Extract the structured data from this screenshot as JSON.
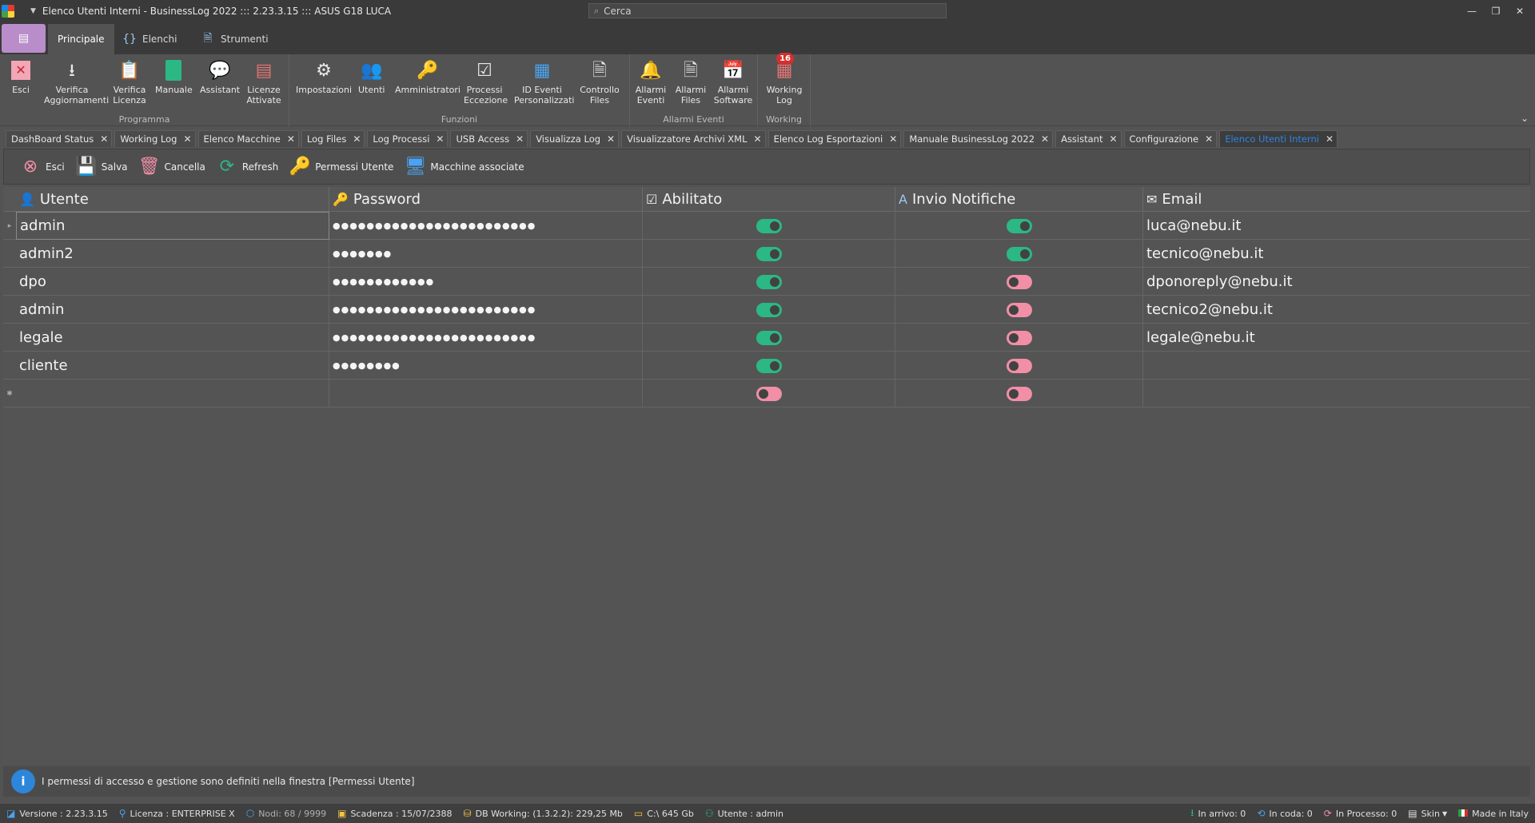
{
  "window": {
    "title": "Elenco Utenti Interni - BusinessLog 2022 ::: 2.23.3.15 ::: ASUS G18 LUCA",
    "search_placeholder": "Cerca"
  },
  "ribbon_tabs": [
    "Principale",
    "Elenchi",
    "Strumenti"
  ],
  "ribbon": {
    "programma": {
      "label": "Programma",
      "buttons": [
        "Esci",
        "Verifica Aggiornamenti",
        "Verifica Licenza",
        "Manuale",
        "Assistant",
        "Licenze Attivate"
      ]
    },
    "funzioni": {
      "label": "Funzioni",
      "buttons": [
        "Impostazioni",
        "Utenti",
        "Amministratori",
        "Processi Eccezione",
        "ID Eventi Personalizzati",
        "Controllo Files"
      ]
    },
    "allarmi": {
      "label": "Allarmi Eventi",
      "buttons": [
        "Allarmi Eventi",
        "Allarmi Files",
        "Allarmi Software"
      ]
    },
    "working": {
      "label": "Working",
      "buttons": [
        "Working Log"
      ],
      "badge": "16"
    }
  },
  "doc_tabs": [
    "DashBoard Status",
    "Working Log",
    "Elenco Macchine",
    "Log Files",
    "Log Processi",
    "USB Access",
    "Visualizza Log",
    "Visualizzatore Archivi XML",
    "Elenco Log Esportazioni",
    "Manuale BusinessLog 2022",
    "Assistant",
    "Configurazione",
    "Elenco Utenti Interni"
  ],
  "toolbar": {
    "esci": "Esci",
    "salva": "Salva",
    "cancella": "Cancella",
    "refresh": "Refresh",
    "permessi": "Permessi Utente",
    "macchine": "Macchine associate"
  },
  "grid": {
    "headers": [
      "Utente",
      "Password",
      "Abilitato",
      "Invio Notifiche",
      "Email"
    ],
    "rows": [
      {
        "utente": "admin",
        "password": "●●●●●●●●●●●●●●●●●●●●●●●●",
        "abilitato": true,
        "notifiche": true,
        "email": "luca@nebu.it"
      },
      {
        "utente": "admin2",
        "password": "●●●●●●●",
        "abilitato": true,
        "notifiche": true,
        "email": "tecnico@nebu.it"
      },
      {
        "utente": "dpo",
        "password": "●●●●●●●●●●●●",
        "abilitato": true,
        "notifiche": false,
        "email": "dponoreply@nebu.it"
      },
      {
        "utente": "admin",
        "password": "●●●●●●●●●●●●●●●●●●●●●●●●",
        "abilitato": true,
        "notifiche": false,
        "email": "tecnico2@nebu.it"
      },
      {
        "utente": "legale",
        "password": "●●●●●●●●●●●●●●●●●●●●●●●●",
        "abilitato": true,
        "notifiche": false,
        "email": "legale@nebu.it"
      },
      {
        "utente": "cliente",
        "password": "●●●●●●●●",
        "abilitato": true,
        "notifiche": false,
        "email": ""
      },
      {
        "utente": "",
        "password": "",
        "abilitato": false,
        "notifiche": false,
        "email": ""
      }
    ]
  },
  "info_message": "I permessi di accesso e gestione sono definiti nella finestra [Permessi Utente]",
  "statusbar": {
    "versione": "Versione : 2.23.3.15",
    "licenza": "Licenza : ENTERPRISE X",
    "nodi": "Nodi: 68 / 9999",
    "scadenza": "Scadenza : 15/07/2388",
    "db": "DB Working: (1.3.2.2): 229,25 Mb",
    "disk": "C:\\ 645 Gb",
    "utente": "Utente : admin",
    "in_arrivo": "In arrivo: 0",
    "in_coda": "In coda: 0",
    "in_processo": "In Processo: 0",
    "skin": "Skin",
    "made_in": "Made in Italy"
  }
}
